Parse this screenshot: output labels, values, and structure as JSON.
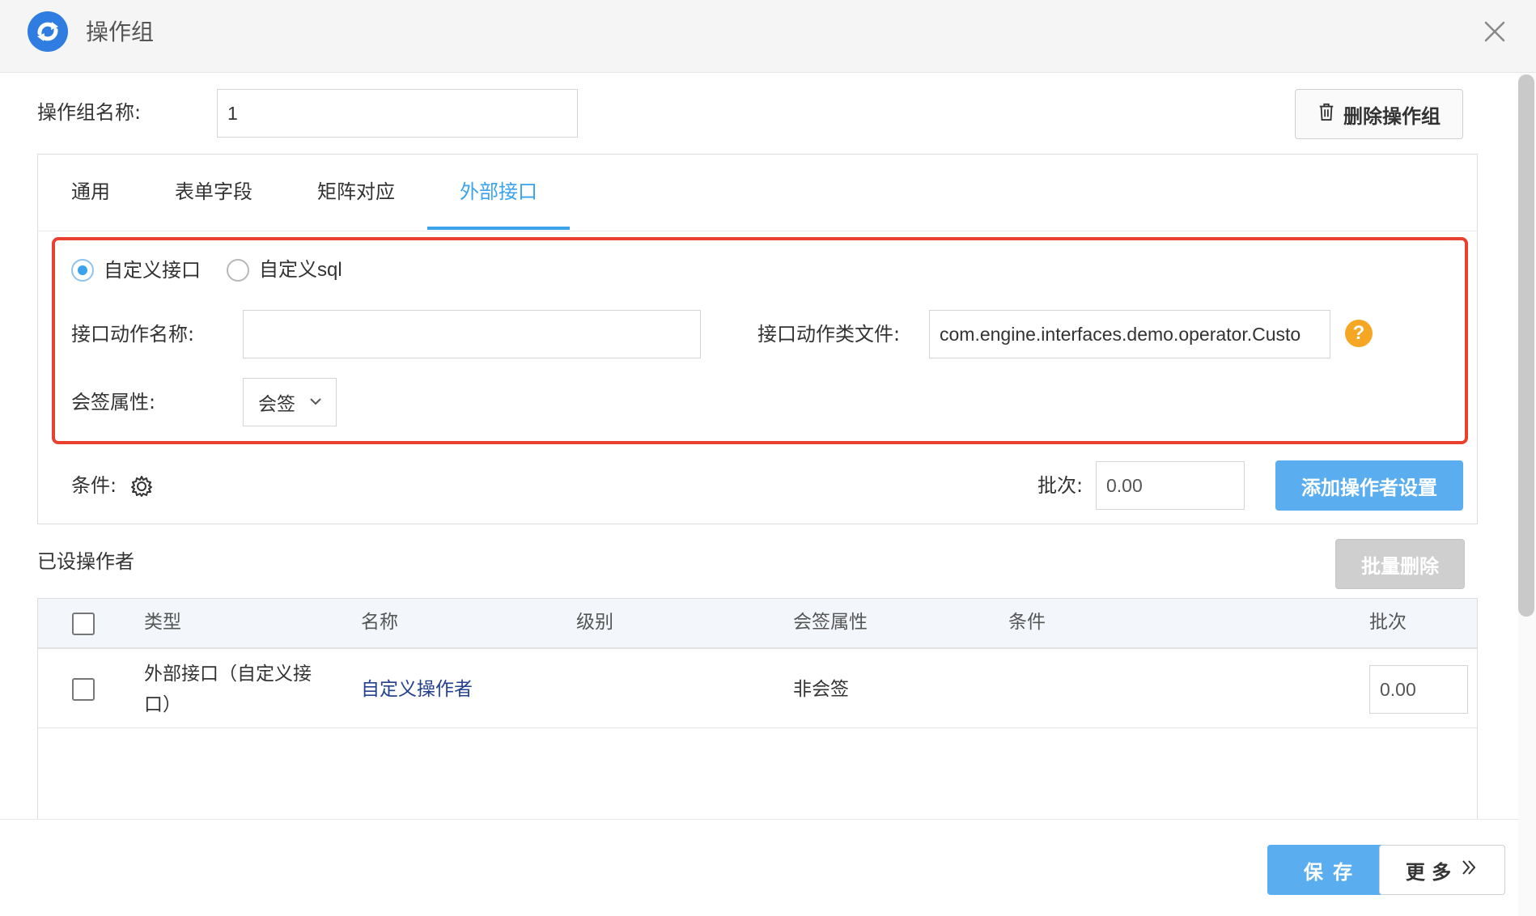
{
  "dialog": {
    "title": "操作组",
    "logo_icon": "sync-logo-icon",
    "close_icon": "close-icon"
  },
  "group_name": {
    "label": "操作组名称:",
    "value": "1"
  },
  "delete_group_button": {
    "label": "删除操作组",
    "icon": "trash-icon"
  },
  "tabs": [
    {
      "label": "通用",
      "active": false
    },
    {
      "label": "表单字段",
      "active": false
    },
    {
      "label": "矩阵对应",
      "active": false
    },
    {
      "label": "外部接口",
      "active": true
    }
  ],
  "external_interface": {
    "mode_options": [
      {
        "label": "自定义接口",
        "checked": true
      },
      {
        "label": "自定义sql",
        "checked": false
      }
    ],
    "action_name": {
      "label": "接口动作名称:",
      "value": ""
    },
    "action_class": {
      "label": "接口动作类文件:",
      "value": "com.engine.interfaces.demo.operator.Custo"
    },
    "help_icon_text": "?",
    "countersign": {
      "label": "会签属性:",
      "selected": "会签"
    }
  },
  "condition": {
    "label": "条件:",
    "icon": "gear-icon"
  },
  "batch": {
    "label": "批次:",
    "value": "0.00"
  },
  "add_operator_button": "添加操作者设置",
  "operators_section": {
    "title": "已设操作者",
    "bulk_delete_button": "批量删除"
  },
  "table": {
    "columns": [
      "类型",
      "名称",
      "级别",
      "会签属性",
      "条件",
      "批次"
    ],
    "rows": [
      {
        "type_line1": "外部接口（自定义接",
        "type_line2": "口）",
        "name": "自定义操作者",
        "level": "",
        "countersign": "非会签",
        "condition": "",
        "batch": "0.00"
      }
    ]
  },
  "footer": {
    "save_button": "保 存",
    "more_button": "更 多"
  },
  "colors": {
    "accent": "#3aa3ec",
    "primary_button": "#5aaeef",
    "highlight_border": "#e8412f",
    "help": "#f5a623",
    "link": "#23418f"
  }
}
